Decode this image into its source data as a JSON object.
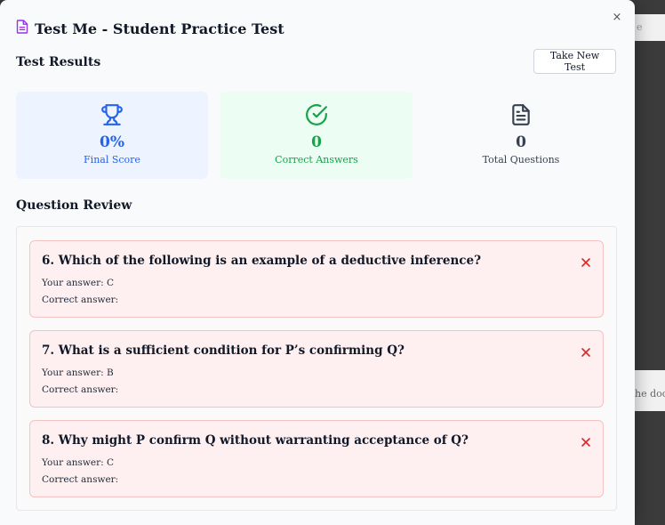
{
  "background": {
    "strip_text": "e",
    "strip2_text": "he doc"
  },
  "modal": {
    "title": "Test Me - Student Practice Test",
    "close_label": "×"
  },
  "results": {
    "heading": "Test Results",
    "take_new_label": "Take New Test",
    "stats": [
      {
        "value": "0%",
        "label": "Final Score",
        "icon": "trophy-icon",
        "color": "#2563eb"
      },
      {
        "value": "0",
        "label": "Correct Answers",
        "icon": "check-circle-icon",
        "color": "#16a34a"
      },
      {
        "value": "0",
        "label": "Total Questions",
        "icon": "document-icon",
        "color": "#374151"
      }
    ]
  },
  "review": {
    "heading": "Question Review",
    "questions": [
      {
        "text": "6. Which of the following is an example of a deductive inference?",
        "your_answer": "Your answer: C",
        "correct_answer": "Correct answer:"
      },
      {
        "text": "7. What is a sufficient condition for P’s confirming Q?",
        "your_answer": "Your answer: B",
        "correct_answer": "Correct answer:"
      },
      {
        "text": "8. Why might P confirm Q without warranting acceptance of Q?",
        "your_answer": "Your answer: C",
        "correct_answer": "Correct answer:"
      }
    ]
  }
}
